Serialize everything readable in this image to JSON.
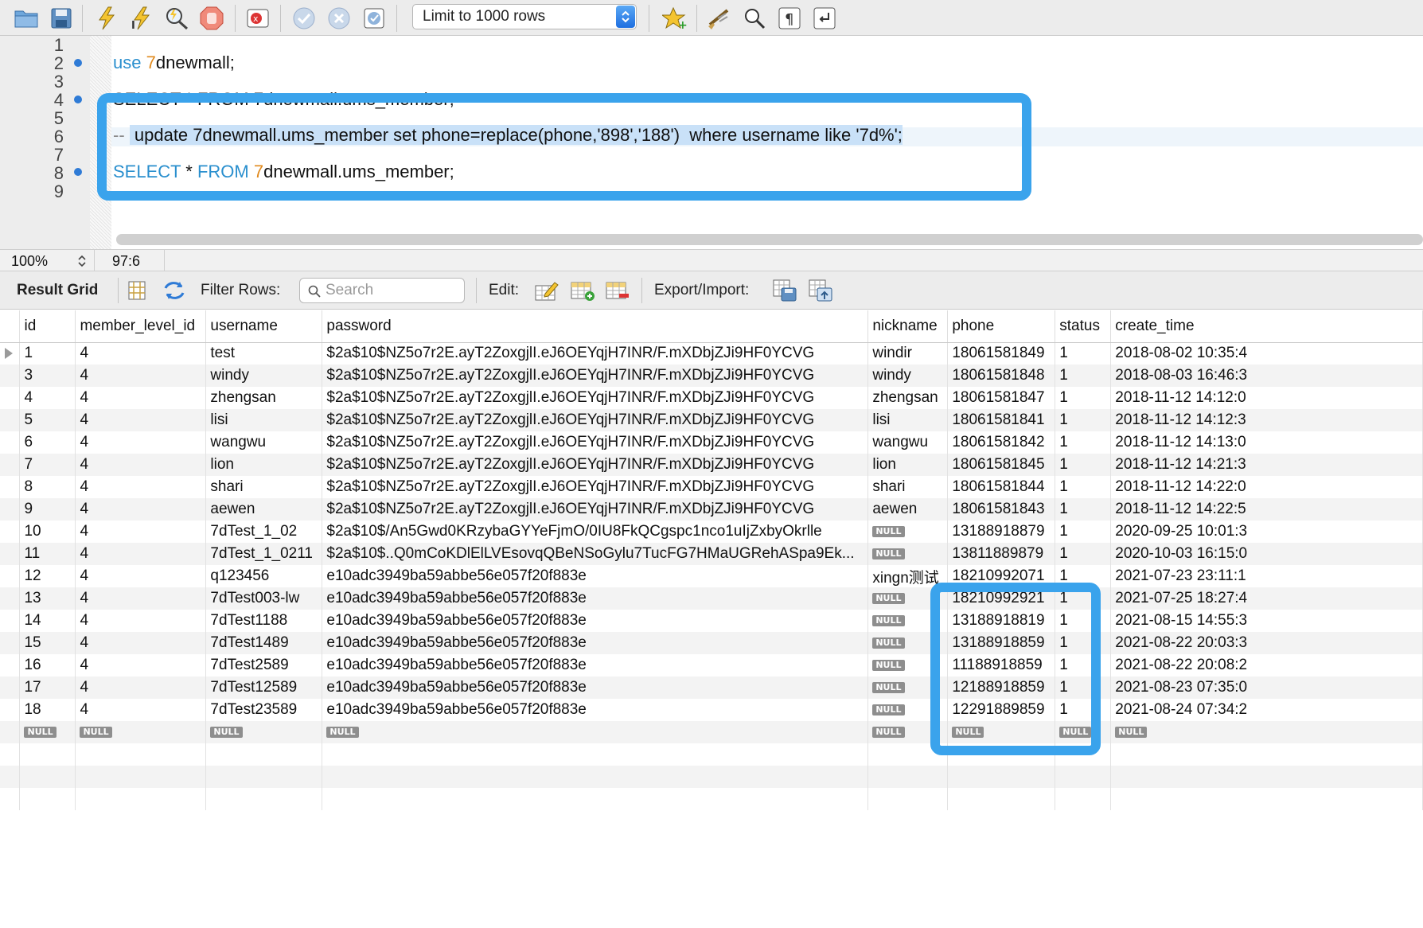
{
  "toolbar": {
    "icons": [
      "open-folder-icon",
      "save-icon",
      "execute-icon",
      "execute-current-icon",
      "explain-icon",
      "stop-icon",
      "stop-on-error-icon",
      "commit-icon",
      "rollback-icon",
      "autocommit-icon",
      "bookmark-icon",
      "beautify-icon",
      "find-icon",
      "invisible-chars-icon",
      "wrap-lines-icon"
    ],
    "limit_select": "Limit to 1000 rows"
  },
  "editor": {
    "line_numbers": [
      "1",
      "2",
      "3",
      "4",
      "5",
      "6",
      "7",
      "8",
      "9"
    ],
    "lines": [
      {
        "kw1": "use",
        "num": "7",
        "rest": "dnewmall;"
      },
      {
        "text": "SELECT * FROM 7dnewmall.ums_member;"
      },
      {
        "prefix": "-- ",
        "selected": " update 7dnewmall.ums_member set phone=replace(phone,'898','188')  where username like '7d%';"
      },
      {
        "kw1": "SELECT",
        "mid": " * ",
        "kw2": "FROM",
        "num": " 7",
        "rest": "dnewmall.ums_member;"
      }
    ]
  },
  "status": {
    "zoom": "100%",
    "cursor": "97:6"
  },
  "result_toolbar": {
    "title": "Result Grid",
    "filter_label": "Filter Rows:",
    "search_placeholder": "Search",
    "edit_label": "Edit:",
    "export_label": "Export/Import:"
  },
  "grid": {
    "columns": [
      "",
      "id",
      "member_level_id",
      "username",
      "password",
      "nickname",
      "phone",
      "status",
      "create_time"
    ],
    "null_text": "NULL",
    "rows": [
      [
        "1",
        "4",
        "test",
        "$2a$10$NZ5o7r2E.ayT2ZoxgjlI.eJ6OEYqjH7INR/F.mXDbjZJi9HF0YCVG",
        "windir",
        "18061581849",
        "1",
        "2018-08-02 10:35:4"
      ],
      [
        "3",
        "4",
        "windy",
        "$2a$10$NZ5o7r2E.ayT2ZoxgjlI.eJ6OEYqjH7INR/F.mXDbjZJi9HF0YCVG",
        "windy",
        "18061581848",
        "1",
        "2018-08-03 16:46:3"
      ],
      [
        "4",
        "4",
        "zhengsan",
        "$2a$10$NZ5o7r2E.ayT2ZoxgjlI.eJ6OEYqjH7INR/F.mXDbjZJi9HF0YCVG",
        "zhengsan",
        "18061581847",
        "1",
        "2018-11-12 14:12:0"
      ],
      [
        "5",
        "4",
        "lisi",
        "$2a$10$NZ5o7r2E.ayT2ZoxgjlI.eJ6OEYqjH7INR/F.mXDbjZJi9HF0YCVG",
        "lisi",
        "18061581841",
        "1",
        "2018-11-12 14:12:3"
      ],
      [
        "6",
        "4",
        "wangwu",
        "$2a$10$NZ5o7r2E.ayT2ZoxgjlI.eJ6OEYqjH7INR/F.mXDbjZJi9HF0YCVG",
        "wangwu",
        "18061581842",
        "1",
        "2018-11-12 14:13:0"
      ],
      [
        "7",
        "4",
        "lion",
        "$2a$10$NZ5o7r2E.ayT2ZoxgjlI.eJ6OEYqjH7INR/F.mXDbjZJi9HF0YCVG",
        "lion",
        "18061581845",
        "1",
        "2018-11-12 14:21:3"
      ],
      [
        "8",
        "4",
        "shari",
        "$2a$10$NZ5o7r2E.ayT2ZoxgjlI.eJ6OEYqjH7INR/F.mXDbjZJi9HF0YCVG",
        "shari",
        "18061581844",
        "1",
        "2018-11-12 14:22:0"
      ],
      [
        "9",
        "4",
        "aewen",
        "$2a$10$NZ5o7r2E.ayT2ZoxgjlI.eJ6OEYqjH7INR/F.mXDbjZJi9HF0YCVG",
        "aewen",
        "18061581843",
        "1",
        "2018-11-12 14:22:5"
      ],
      [
        "10",
        "4",
        "7dTest_1_02",
        "$2a$10$/An5Gwd0KRzybaGYYeFjmO/0IU8FkQCgspc1nco1uIjZxbyOkrlle",
        null,
        "13188918879",
        "1",
        "2020-09-25 10:01:3"
      ],
      [
        "11",
        "4",
        "7dTest_1_0211",
        "$2a$10$..Q0mCoKDlElLVEsovqQBeNSoGylu7TucFG7HMaUGRehASpa9Ek...",
        null,
        "13811889879",
        "1",
        "2020-10-03 16:15:0"
      ],
      [
        "12",
        "4",
        "q123456",
        "e10adc3949ba59abbe56e057f20f883e",
        "xingn测试",
        "18210992071",
        "1",
        "2021-07-23 23:11:1"
      ],
      [
        "13",
        "4",
        "7dTest003-lw",
        "e10adc3949ba59abbe56e057f20f883e",
        null,
        "18210992921",
        "1",
        "2021-07-25 18:27:4"
      ],
      [
        "14",
        "4",
        "7dTest1188",
        "e10adc3949ba59abbe56e057f20f883e",
        null,
        "13188918819",
        "1",
        "2021-08-15 14:55:3"
      ],
      [
        "15",
        "4",
        "7dTest1489",
        "e10adc3949ba59abbe56e057f20f883e",
        null,
        "13188918859",
        "1",
        "2021-08-22 20:03:3"
      ],
      [
        "16",
        "4",
        "7dTest2589",
        "e10adc3949ba59abbe56e057f20f883e",
        null,
        "11188918859",
        "1",
        "2021-08-22 20:08:2"
      ],
      [
        "17",
        "4",
        "7dTest12589",
        "e10adc3949ba59abbe56e057f20f883e",
        null,
        "12188918859",
        "1",
        "2021-08-23 07:35:0"
      ],
      [
        "18",
        "4",
        "7dTest23589",
        "e10adc3949ba59abbe56e057f20f883e",
        null,
        "12291889859",
        "1",
        "2021-08-24 07:34:2"
      ],
      [
        null,
        null,
        null,
        null,
        null,
        null,
        null,
        null
      ]
    ]
  },
  "colors": {
    "annotation": "#3aa3ec",
    "keyword": "#2a8fce",
    "number": "#e08a1e"
  }
}
